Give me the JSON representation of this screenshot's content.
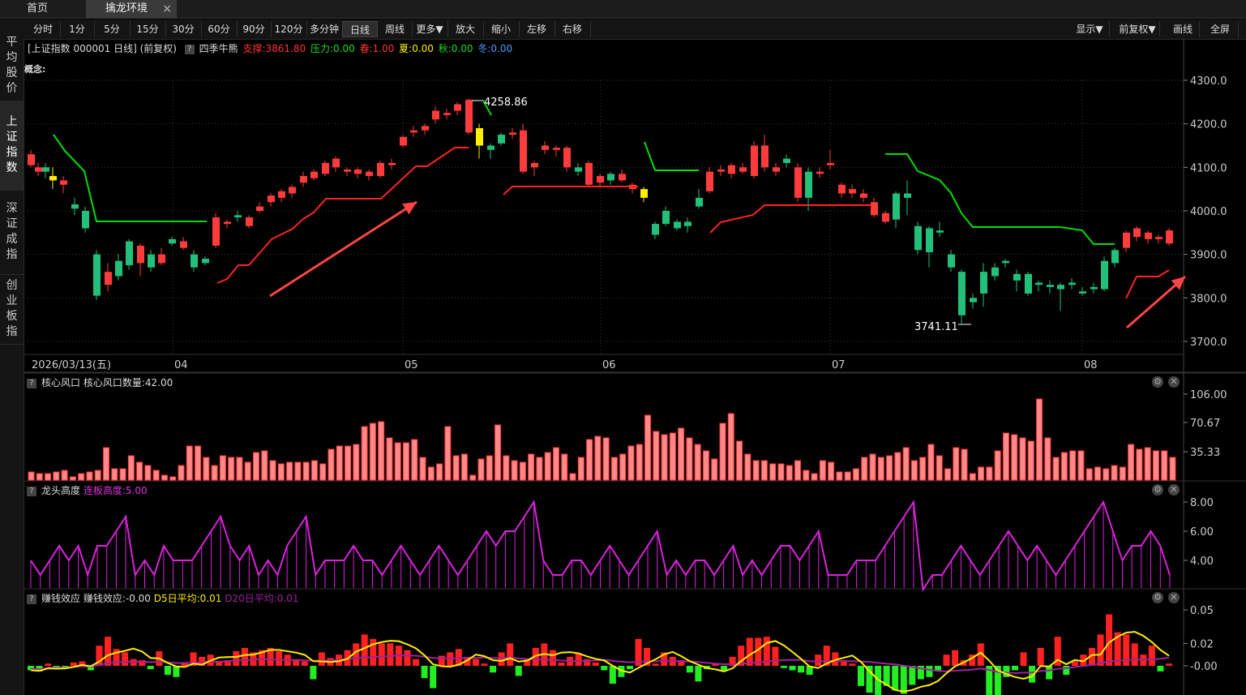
{
  "tabs": [
    {
      "label": "首页"
    },
    {
      "label": "擒龙环境",
      "close": "×"
    }
  ],
  "sidebar": [
    {
      "label": "平均股价"
    },
    {
      "label": "上证指数",
      "active": true
    },
    {
      "label": "深证成指"
    },
    {
      "label": "创业板指"
    }
  ],
  "toolbar": {
    "left": [
      "分时",
      "1分",
      "5分",
      "15分",
      "30分",
      "60分",
      "90分",
      "120分",
      "多分钟",
      "日线",
      "周线",
      "更多▼",
      "放大",
      "缩小",
      "左移",
      "右移"
    ],
    "selected": "日线",
    "right": [
      "显示▼",
      "前复权▼",
      "画线",
      "全屏"
    ]
  },
  "info": {
    "title": "[上证指数 000001 日线]  (前复权)",
    "q": "?",
    "indicator": "四季牛熊",
    "support": "支撑:3861.80",
    "pressure": "压力:0.00",
    "spring": "春:1.00",
    "summer": "夏:0.00",
    "autumn": "秋:0.00",
    "winter": "冬:0.00",
    "concept": "概念:"
  },
  "colors": {
    "up": "#ff3b3b",
    "down": "#22c07a",
    "yellow": "#ffee00",
    "green": "#00dd00",
    "red": "#ff2222",
    "magenta": "#dd22dd",
    "purple": "#a020a0",
    "bg": "#000000",
    "grid": "#3a3a3a"
  },
  "main_chart": {
    "y_ticks": [
      "4300.0",
      "4200.0",
      "4100.0",
      "4000.0",
      "3900.0",
      "3800.0",
      "3700.0"
    ],
    "x_labels": [
      "2026/03/13(五)",
      "04",
      "05",
      "06",
      "07",
      "08"
    ],
    "high_label": "4258.86",
    "low_label": "3741.11"
  },
  "panel1": {
    "q": "?",
    "title": "核心风口",
    "value": "核心风口数量:42.00",
    "y_ticks": [
      "106.00",
      "70.67",
      "35.33"
    ],
    "values": [
      10,
      8,
      8,
      10,
      12,
      4,
      8,
      10,
      12,
      40,
      14,
      14,
      30,
      22,
      18,
      12,
      6,
      4,
      18,
      42,
      42,
      28,
      18,
      30,
      28,
      28,
      22,
      34,
      36,
      24,
      20,
      22,
      22,
      22,
      24,
      20,
      38,
      42,
      42,
      44,
      66,
      70,
      72,
      52,
      46,
      46,
      50,
      28,
      16,
      20,
      66,
      30,
      32,
      6,
      26,
      30,
      68,
      30,
      24,
      22,
      32,
      28,
      34,
      40,
      32,
      8,
      28,
      50,
      54,
      52,
      28,
      32,
      42,
      44,
      80,
      60,
      56,
      58,
      64,
      52,
      44,
      36,
      26,
      70,
      82,
      48,
      32,
      24,
      24,
      20,
      20,
      18,
      24,
      12,
      8,
      24,
      22,
      10,
      10,
      14,
      28,
      32,
      28,
      30,
      34,
      40,
      24,
      28,
      44,
      30,
      14,
      40,
      38,
      8,
      16,
      16,
      36,
      58,
      56,
      52,
      48,
      100,
      52,
      28,
      34,
      36,
      36,
      14,
      16,
      14,
      18,
      16,
      44,
      38,
      40,
      36,
      36,
      28
    ],
    "max": 106
  },
  "panel2": {
    "q": "?",
    "title": "龙头高度",
    "value": "连板高度:5.00",
    "y_ticks": [
      "8.00",
      "6.00",
      "4.00"
    ]
  },
  "panel3": {
    "q": "?",
    "title": "赚钱效应",
    "value": "赚钱效应:-0.00",
    "d5": "D5日平均:0.01",
    "d20": "D20日平均:0.01",
    "y_ticks": [
      "0.05",
      "0.02",
      "-0.00"
    ]
  },
  "panel_icons": {
    "gear": "⚙",
    "close": "✕"
  },
  "chart_data": [
    {
      "type": "candlestick",
      "title": "上证指数 日线",
      "ylim": [
        3700,
        4300
      ],
      "x_labels": [
        "2026/03/13(五)",
        "04",
        "05",
        "06",
        "07",
        "08"
      ],
      "annotations": [
        {
          "label": "4258.86",
          "kind": "high"
        },
        {
          "label": "3741.11",
          "kind": "low"
        }
      ],
      "indicator": "四季牛熊"
    },
    {
      "type": "bar",
      "title": "核心风口",
      "ylim": [
        0,
        106
      ]
    },
    {
      "type": "line",
      "title": "龙头高度",
      "ylim": [
        2,
        8
      ]
    },
    {
      "type": "bar",
      "title": "赚钱效应",
      "ylim": [
        -0.02,
        0.05
      ]
    }
  ]
}
